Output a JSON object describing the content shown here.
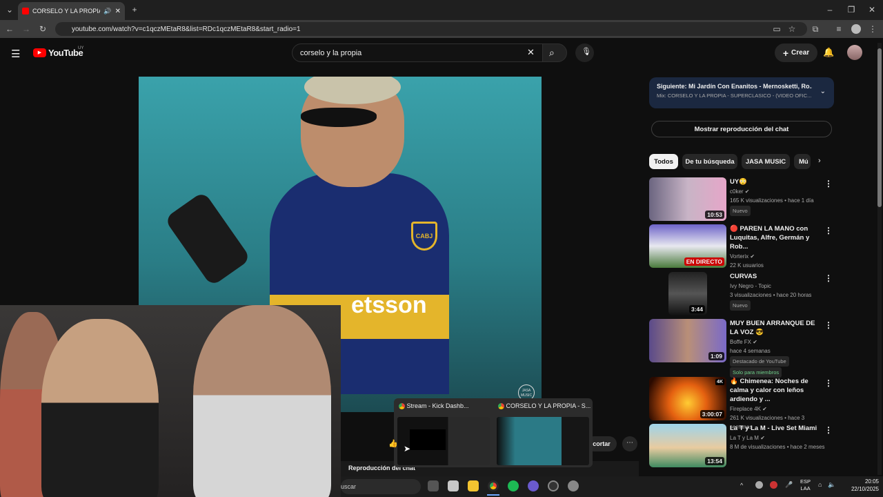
{
  "browser": {
    "tab_title": "CORSELO Y LA PROPIA - S",
    "url": "youtube.com/watch?v=c1qczMEtaR8&list=RDc1qczMEtaR8&start_radio=1"
  },
  "header": {
    "logo_text": "YouTube",
    "region": "UY",
    "search_value": "corselo y la propia",
    "create_label": "Crear"
  },
  "video": {
    "sponsor_text": "etsson",
    "crest_text": "CABJ",
    "watermark": "JASA MUSIC"
  },
  "sidebar": {
    "next_prefix": "Siguiente:",
    "next_title": "Mi Jardín Con Enanitos - Mernosketti, Ro...",
    "next_mix": "Mix: CORSELO Y LA PROPIA - SUPERCLASICO - (VIDEO OFIC...",
    "chat_button": "Mostrar reproducción del chat",
    "chips": [
      "Todos",
      "De tu búsqueda",
      "JASA MUSIC",
      "Mú"
    ],
    "recs": [
      {
        "title": "UY😳",
        "channel": "c0ker",
        "stats": "165 K visualizaciones • hace 1 día",
        "badge": "Nuevo",
        "duration": "10:53"
      },
      {
        "title": "🔴 PAREN LA MANO con Luquitas, Alfre, Germán y Rob...",
        "channel": "Vorterix",
        "stats": "22 K usuarios",
        "badge": "",
        "duration": "EN DIRECTO"
      },
      {
        "title": "CURVAS",
        "channel": "Ivy Negro - Topic",
        "stats": "3 visualizaciones • hace 20 horas",
        "badge": "Nuevo",
        "duration": "3:44"
      },
      {
        "title": "MUY BUEN ARRANQUE DE LA VOZ 😎",
        "channel": "Boffe FX",
        "stats": "hace 4 semanas",
        "badge": "Destacado de YouTube",
        "badge2": "Solo para miembros",
        "duration": "1:09"
      },
      {
        "title": "🔥 Chimenea: Noches de calma y calor con leños ardiendo y ...",
        "channel": "Fireplace 4K",
        "stats": "261 K visualizaciones • hace 3 semanas",
        "badge": "",
        "duration": "3:00:07"
      },
      {
        "title": "La T y La M - Live Set Miami",
        "channel": "La T y La M",
        "stats": "8 M de visualizaciones • hace 2 meses",
        "badge": "",
        "duration": "13:54"
      }
    ]
  },
  "preview": {
    "win1": "Stream - Kick Dashb...",
    "win2": "CORSELO Y LA PROPIA - S..."
  },
  "player_controls": {
    "chat_replay": "Reproducción del chat",
    "cut_label": "cortar"
  },
  "taskbar": {
    "search_text": "uscar",
    "lang": "ESP",
    "lang2": "LAA",
    "time": "20:05",
    "date": "22/10/2025"
  }
}
